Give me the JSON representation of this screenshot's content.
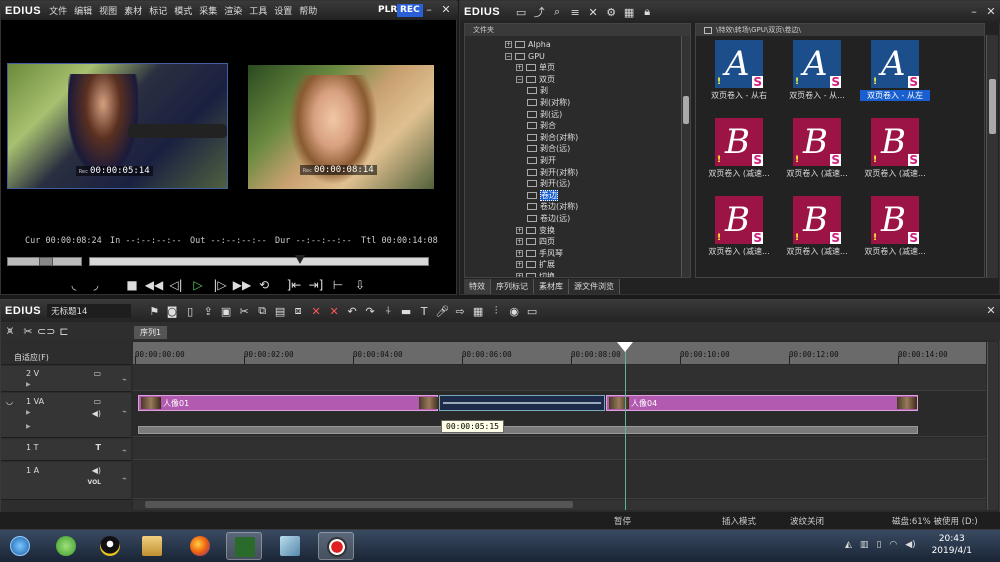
{
  "player": {
    "logo": "EDIUS",
    "menu": [
      "文件",
      "编辑",
      "视图",
      "素材",
      "标记",
      "模式",
      "采集",
      "渲染",
      "工具",
      "设置",
      "帮助"
    ],
    "plr": "PLR",
    "rec": "REC",
    "tc_left": "00:00:05:14",
    "tc_right": "00:00:08:14",
    "tc_prefix": "Rec",
    "cur_label": "Cur",
    "cur_value": "00:00:08:24",
    "in_label": "In",
    "in_value": "--:--:--:--",
    "out_label": "Out",
    "out_value": "--:--:--:--",
    "dur_label": "Dur",
    "dur_value": "--:--:--:--",
    "ttl_label": "Ttl",
    "ttl_value": "00:00:14:08"
  },
  "bin": {
    "logo": "EDIUS",
    "tree_header": "文件夹",
    "path": "\\特效\\转场\\GPU\\双页\\卷边\\",
    "tree": [
      {
        "label": "Alpha",
        "indent": 0,
        "type": "box"
      },
      {
        "label": "GPU",
        "indent": 0,
        "type": "open"
      },
      {
        "label": "单页",
        "indent": 1,
        "type": "box"
      },
      {
        "label": "双页",
        "indent": 1,
        "type": "open"
      },
      {
        "label": "剥",
        "indent": 2,
        "type": "leaf"
      },
      {
        "label": "剥(对称)",
        "indent": 2,
        "type": "leaf"
      },
      {
        "label": "剥(远)",
        "indent": 2,
        "type": "leaf"
      },
      {
        "label": "剥合",
        "indent": 2,
        "type": "leaf"
      },
      {
        "label": "剥合(对称)",
        "indent": 2,
        "type": "leaf"
      },
      {
        "label": "剥合(远)",
        "indent": 2,
        "type": "leaf"
      },
      {
        "label": "剥开",
        "indent": 2,
        "type": "leaf"
      },
      {
        "label": "剥开(对称)",
        "indent": 2,
        "type": "leaf"
      },
      {
        "label": "剥开(远)",
        "indent": 2,
        "type": "leaf"
      },
      {
        "label": "卷边",
        "indent": 2,
        "type": "leaf",
        "selected": true
      },
      {
        "label": "卷边(对称)",
        "indent": 2,
        "type": "leaf"
      },
      {
        "label": "卷边(远)",
        "indent": 2,
        "type": "leaf"
      },
      {
        "label": "变换",
        "indent": 1,
        "type": "box"
      },
      {
        "label": "四页",
        "indent": 1,
        "type": "box"
      },
      {
        "label": "手风琴",
        "indent": 1,
        "type": "box"
      },
      {
        "label": "扩展",
        "indent": 1,
        "type": "box"
      },
      {
        "label": "切换",
        "indent": 1,
        "type": "box"
      }
    ],
    "thumbs": [
      {
        "label": "双页卷入 - 从右",
        "letter": "A",
        "bg": "#1d4e8c",
        "selected": false
      },
      {
        "label": "双页卷入 - 从...",
        "letter": "A",
        "bg": "#1d4e8c",
        "selected": false
      },
      {
        "label": "双页卷入 - 从左",
        "letter": "A",
        "bg": "#1d4e8c",
        "selected": true
      },
      {
        "label": "双页卷入 (减速...",
        "letter": "B",
        "bg": "#9c1346",
        "selected": false
      },
      {
        "label": "双页卷入 (减速...",
        "letter": "B",
        "bg": "#9c1346",
        "selected": false
      },
      {
        "label": "双页卷入 (减速...",
        "letter": "B",
        "bg": "#9c1346",
        "selected": false
      },
      {
        "label": "双页卷入 (减速...",
        "letter": "B",
        "bg": "#9c1346",
        "selected": false
      },
      {
        "label": "双页卷入 (减速...",
        "letter": "B",
        "bg": "#9c1346",
        "selected": false
      },
      {
        "label": "双页卷入 (减速...",
        "letter": "B",
        "bg": "#9c1346",
        "selected": false
      }
    ],
    "tabs": [
      "特效",
      "序列标记",
      "素材库",
      "源文件浏览"
    ]
  },
  "timeline": {
    "logo": "EDIUS",
    "project": "无标题14",
    "seq_tab": "序列1",
    "mode": "自适应(F)",
    "ruler": [
      "00:00:00:00",
      "00:00:02:00",
      "00:00:04:00",
      "00:00:06:00",
      "00:00:08:00",
      "00:00:10:00",
      "00:00:12:00",
      "00:00:14:00"
    ],
    "tracks": [
      {
        "name": "2 V",
        "type": "v"
      },
      {
        "name": "1 VA",
        "type": "va"
      },
      {
        "name": "1 T",
        "type": "t"
      },
      {
        "name": "1 A",
        "type": "a",
        "sub": "VOL"
      }
    ],
    "clip1": "人像01",
    "clip2": "人像04",
    "tooltip": "00:00:05:15",
    "status": {
      "pause": "暂停",
      "mode": "插入模式",
      "ripple": "波纹关闭",
      "disk": "磁盘:61% 被使用 (D:)"
    }
  },
  "taskbar": {
    "time": "20:43",
    "date": "2019/4/1"
  }
}
